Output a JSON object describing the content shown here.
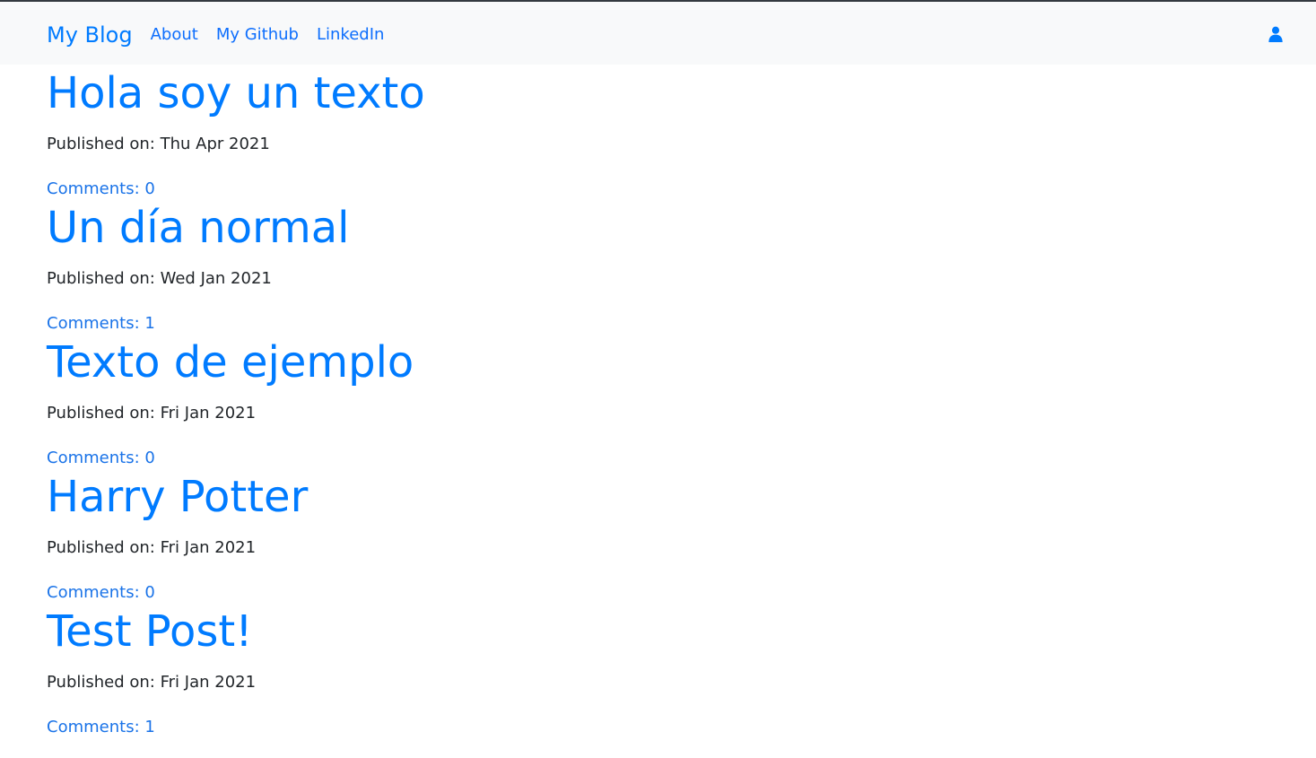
{
  "navbar": {
    "brand": "My Blog",
    "links": [
      {
        "label": "About"
      },
      {
        "label": "My Github"
      },
      {
        "label": "LinkedIn"
      }
    ],
    "user_icon": "user-icon"
  },
  "posts": [
    {
      "title": "Hola soy un texto",
      "published_label": "Published on:",
      "published": "Thu Apr 2021",
      "comments": "Comments: 0"
    },
    {
      "title": "Un día normal",
      "published_label": "Published on:",
      "published": "Wed Jan 2021",
      "comments": "Comments: 1"
    },
    {
      "title": "Texto de ejemplo",
      "published_label": "Published on:",
      "published": "Fri Jan 2021",
      "comments": "Comments: 0"
    },
    {
      "title": "Harry Potter",
      "published_label": "Published on:",
      "published": "Fri Jan 2021",
      "comments": "Comments: 0"
    },
    {
      "title": "Test Post!",
      "published_label": "Published on:",
      "published": "Fri Jan 2021",
      "comments": "Comments: 1"
    }
  ],
  "colors": {
    "accent": "#007bff",
    "navbar_bg": "#f8f9fa",
    "text": "#212529"
  }
}
